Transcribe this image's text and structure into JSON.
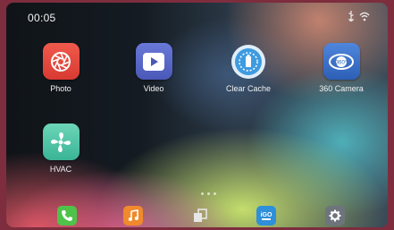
{
  "status_bar": {
    "time": "00:05",
    "icons": [
      "usb-icon",
      "wifi-icon"
    ]
  },
  "apps": [
    {
      "label": "Photo",
      "icon": "photo-aperture-icon",
      "color": "#e8403a"
    },
    {
      "label": "Video",
      "icon": "video-play-icon",
      "color": "#5a68c8"
    },
    {
      "label": "Clear Cache",
      "icon": "clear-cache-icon",
      "color": "#4aa3e0"
    },
    {
      "label": "360 Camera",
      "icon": "360-camera-icon",
      "color": "#3b6fc4"
    },
    {
      "label": "HVAC",
      "icon": "hvac-fan-icon",
      "color": "#53c4a8"
    }
  ],
  "pager": {
    "pages": 3,
    "current": 2
  },
  "dock": [
    {
      "icon": "phone-icon",
      "color": "#4fc24a"
    },
    {
      "icon": "music-icon",
      "color": "#f08a2c"
    },
    {
      "icon": "link-icon",
      "color": "#d8d8d8"
    },
    {
      "icon": "igo-navigation-icon",
      "color": "#2f8fd8"
    },
    {
      "icon": "settings-gear-icon",
      "color": "#7a8088"
    }
  ]
}
